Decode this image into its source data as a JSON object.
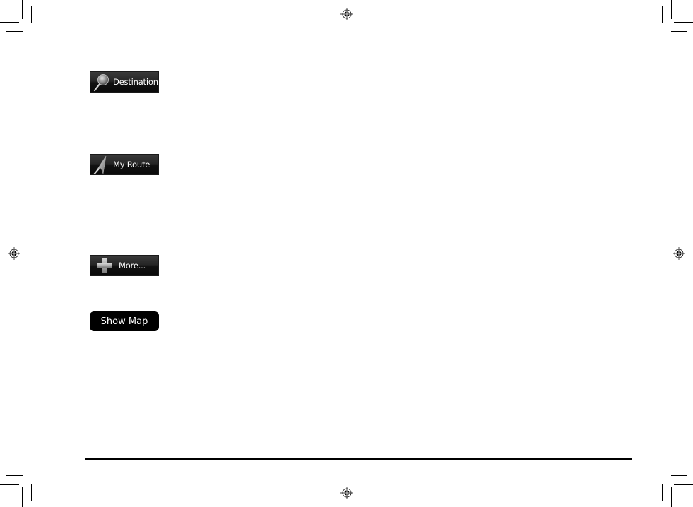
{
  "buttons": {
    "destination": {
      "label": "Destination",
      "icon": "magnifier-icon"
    },
    "my_route": {
      "label": "My Route",
      "icon": "route-arrow-icon"
    },
    "more": {
      "label": "More...",
      "icon": "plus-icon"
    },
    "show_map": {
      "label": "Show Map"
    }
  },
  "colors": {
    "button_background": "#1a1a1a",
    "button_text": "#ffffff",
    "page_background": "#ffffff",
    "rule": "#000000"
  }
}
